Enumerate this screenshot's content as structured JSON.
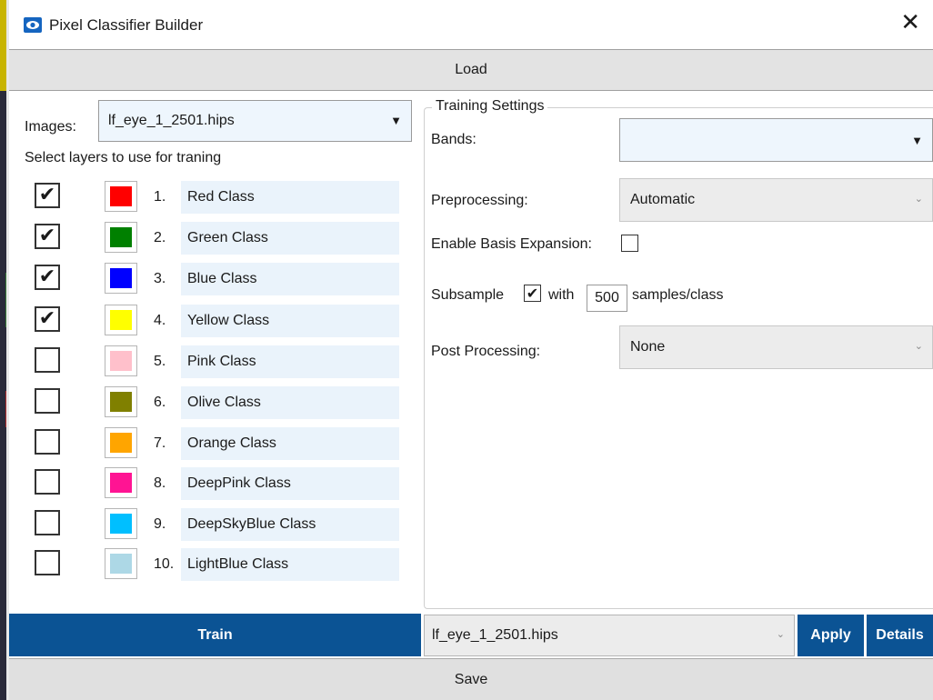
{
  "window": {
    "title": "Pixel Classifier Builder",
    "close_glyph": "✕"
  },
  "load_label": "Load",
  "images": {
    "label": "Images:",
    "selected": "lf_eye_1_2501.hips",
    "caret": "▼"
  },
  "layers_hint": "Select layers to use for traning",
  "layers": [
    {
      "num": "1.",
      "name": "Red Class",
      "color": "#ff0000",
      "checked": true
    },
    {
      "num": "2.",
      "name": "Green Class",
      "color": "#008000",
      "checked": true
    },
    {
      "num": "3.",
      "name": "Blue Class",
      "color": "#0000ff",
      "checked": true
    },
    {
      "num": "4.",
      "name": "Yellow Class",
      "color": "#ffff00",
      "checked": true
    },
    {
      "num": "5.",
      "name": "Pink Class",
      "color": "#ffc0cb",
      "checked": false
    },
    {
      "num": "6.",
      "name": "Olive Class",
      "color": "#808000",
      "checked": false
    },
    {
      "num": "7.",
      "name": "Orange Class",
      "color": "#ffa500",
      "checked": false
    },
    {
      "num": "8.",
      "name": "DeepPink Class",
      "color": "#ff1493",
      "checked": false
    },
    {
      "num": "9.",
      "name": "DeepSkyBlue Class",
      "color": "#00bfff",
      "checked": false
    },
    {
      "num": "10.",
      "name": "LightBlue Class",
      "color": "#add8e6",
      "checked": false
    }
  ],
  "training": {
    "title": "Training Settings",
    "bands_label": "Bands:",
    "bands_value": "",
    "bands_caret": "▼",
    "preprocessing_label": "Preprocessing:",
    "preprocessing_value": "Automatic",
    "basis_label": "Enable Basis Expansion:",
    "basis_checked": false,
    "subsample_label": "Subsample",
    "subsample_checked": true,
    "with_label": "with",
    "samples_value": "500",
    "samples_suffix": "samples/class",
    "post_label": "Post Processing:",
    "post_value": "None",
    "select_caret": "⌄"
  },
  "bottom": {
    "train_label": "Train",
    "file_value": "lf_eye_1_2501.hips",
    "apply_label": "Apply",
    "details_label": "Details",
    "save_label": "Save"
  },
  "colors": {
    "accent": "#0b5394",
    "input_bg": "#eef6fd"
  },
  "check_glyph": "✔"
}
